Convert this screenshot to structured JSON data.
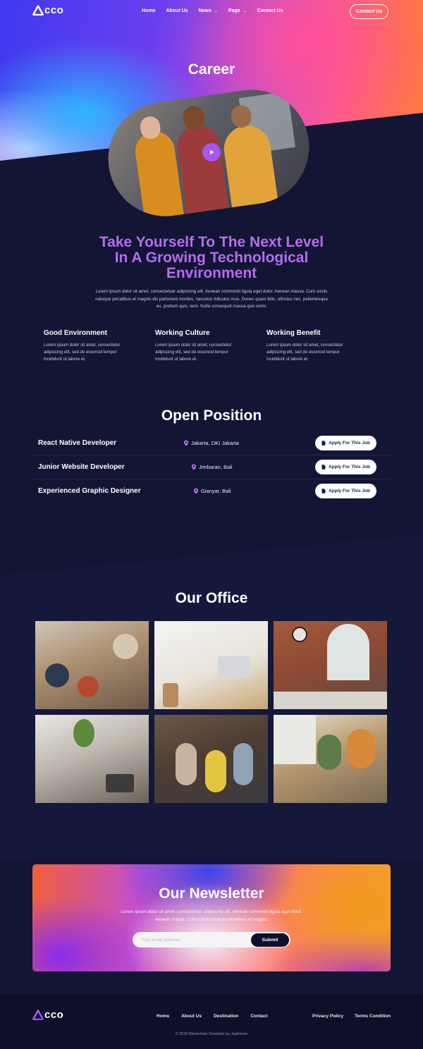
{
  "nav": {
    "logo_text": "cco",
    "links": [
      {
        "label": "Home",
        "chevron": false
      },
      {
        "label": "About Us",
        "chevron": false
      },
      {
        "label": "News",
        "chevron": true
      },
      {
        "label": "Page",
        "chevron": true
      },
      {
        "label": "Contact Us",
        "chevron": false
      }
    ],
    "cta_label": "Contact Us"
  },
  "hero": {
    "title": "Career",
    "play_icon": "play-icon"
  },
  "intro": {
    "title_lines": [
      "Take Yourself To The Next Level",
      "In A Growing Technological",
      "Environment"
    ],
    "paragraph": "Lorem ipsum dolor sit amet, consectetuer adipiscing elit. Aenean commodo ligula eget dolor. Aenean massa. Cum sociis natoque penatibus et magnis dis parturient montes, nascetur ridiculus mus. Donec quam felis, ultricies nec, pellentesque eu, pretium quis, sem. Nulla consequat massa quis enim.",
    "features": [
      {
        "title": "Good Environment",
        "text": "Lorem ipsum dolor sit amet, consectetur adipiscing elit, sed do eiusmod tempor incididunt ut labore et."
      },
      {
        "title": "Working Culture",
        "text": "Lorem ipsum dolor sit amet, consectetur adipiscing elit, sed do eiusmod tempor incididunt ut labore et."
      },
      {
        "title": "Working Benefit",
        "text": "Lorem ipsum dolor sit amet, consectetur adipiscing elit, sed do eiusmod tempor incididunt ut labore et."
      }
    ]
  },
  "positions": {
    "title": "Open Position",
    "apply_label": "Apply For This Job",
    "items": [
      {
        "title": "React Native Developer",
        "location": "Jakarta, DKI Jakarta"
      },
      {
        "title": "Junior Website Developer",
        "location": "Jimbaran, Bali"
      },
      {
        "title": "Experienced Graphic Designer",
        "location": "Gianyar, Bali"
      }
    ]
  },
  "office": {
    "title": "Our Office",
    "photos": [
      "team-meeting-photo",
      "desk-workspace-photo",
      "brick-office-photo",
      "coworking-space-photo",
      "team-celebration-photo",
      "team-discussion-photo"
    ]
  },
  "newsletter": {
    "title": "Our Newsletter",
    "text": "Lorem ipsum dolor sit amet, consectetuer adipiscing elit. Aenean commodo ligula eget dolor. Aenean massa. Cum sociis natoque penatibus et magnis.",
    "placeholder": "Your email address",
    "submit_label": "Submit"
  },
  "footer": {
    "logo_text": "cco",
    "links": [
      "Home",
      "About Us",
      "Destination",
      "Contact"
    ],
    "legal": [
      "Privacy Policy",
      "Terms Condition"
    ],
    "copyright": "© 2020 Blockchain Template by Jegtheme"
  },
  "colors": {
    "background": "#131534",
    "accent_purple": "#b56cf0",
    "play_button": "#a656f5",
    "footer_bg": "#0e1029"
  }
}
